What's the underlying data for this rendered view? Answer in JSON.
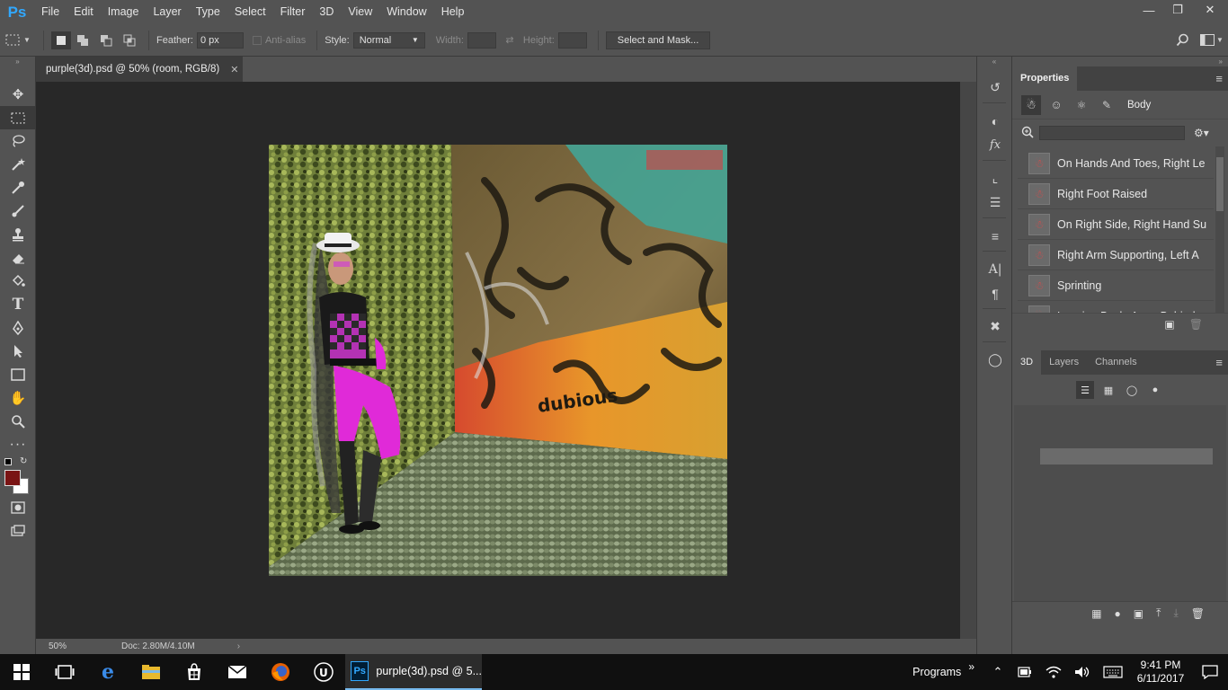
{
  "app": {
    "logo": "Ps",
    "menu": [
      "File",
      "Edit",
      "Image",
      "Layer",
      "Type",
      "Select",
      "Filter",
      "3D",
      "View",
      "Window",
      "Help"
    ],
    "window_controls": [
      "minimize",
      "restore",
      "close"
    ]
  },
  "options_bar": {
    "feather_label": "Feather:",
    "feather_value": "0 px",
    "antialias_label": "Anti-alias",
    "style_label": "Style:",
    "style_value": "Normal",
    "width_label": "Width:",
    "height_label": "Height:",
    "select_mask_label": "Select and Mask..."
  },
  "document": {
    "tab_title": "purple(3d).psd @ 50% (room, RGB/8)",
    "zoom": "50%",
    "doc_info": "Doc: 2.80M/4.10M",
    "artwork_text": "dubious"
  },
  "properties": {
    "title": "Properties",
    "section": "Body",
    "poses": [
      "On Hands And Toes, Right Le",
      "Right Foot Raised",
      "On Right Side, Right Hand Su",
      "Right Arm Supporting, Left A",
      "Sprinting",
      "Leaning Back, Arms Behind"
    ]
  },
  "lower_panel": {
    "tabs": [
      "3D",
      "Layers",
      "Channels"
    ]
  },
  "taskbar": {
    "active_app_label": "purple(3d).psd @ 5...",
    "programs_label": "Programs",
    "time": "9:41 PM",
    "date": "6/11/2017"
  },
  "colors": {
    "foreground": "#7a1414",
    "background": "#ffffff",
    "ui_panel": "#535353",
    "canvas_bg": "#282828",
    "ps_blue": "#31a8ff"
  }
}
